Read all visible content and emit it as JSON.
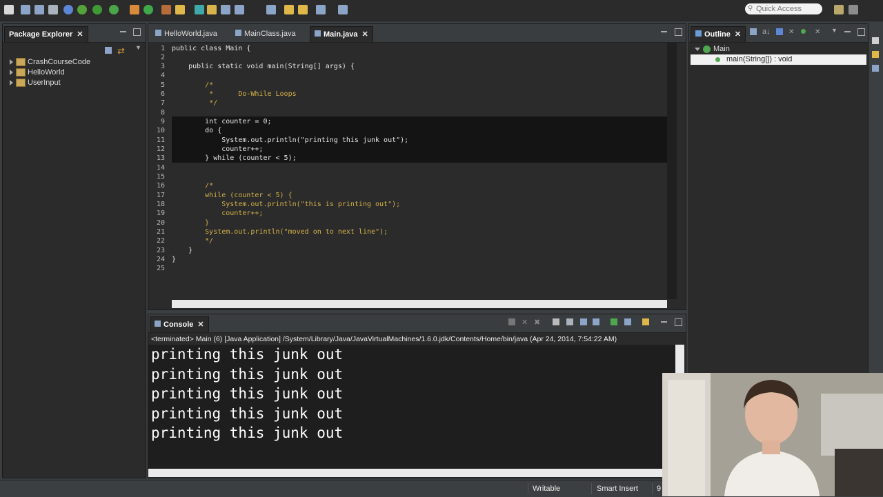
{
  "toolbar": {
    "search_placeholder": "Quick Access",
    "buttons": [
      "new-icon",
      "save-icon",
      "save-all-icon",
      "print-icon",
      "debug-icon",
      "run-icon",
      "run-last-icon",
      "external-tools-icon",
      "new-package-icon",
      "new-class-icon",
      "open-type-icon",
      "search-icon",
      "annotation-icon",
      "next-annotation-icon",
      "prev-annotation-icon",
      "back-icon",
      "forward-icon",
      "pin-icon"
    ]
  },
  "package_explorer": {
    "title": "Package Explorer",
    "projects": [
      "CrashCourseCode",
      "HelloWorld",
      "UserInput"
    ]
  },
  "editor": {
    "tabs": [
      {
        "label": "HelloWorld.java",
        "active": false
      },
      {
        "label": "MainClass.java",
        "active": false
      },
      {
        "label": "Main.java",
        "active": true
      }
    ],
    "line_numbers": [
      "1",
      "2",
      "3",
      "4",
      "5",
      "6",
      "7",
      "8",
      "9",
      "10",
      "11",
      "12",
      "13",
      "14",
      "15",
      "16",
      "17",
      "18",
      "19",
      "20",
      "21",
      "22",
      "23",
      "24",
      "25"
    ],
    "lines": [
      "public class Main {",
      "",
      "    public static void main(String[] args) {",
      "",
      "        /*",
      "         *      Do-While Loops",
      "         */",
      "",
      "        int counter = 0;",
      "        do {",
      "            System.out.println(\"printing this junk out\");",
      "            counter++;",
      "        } while (counter < 5);",
      "",
      "",
      "        /*",
      "        while (counter < 5) {",
      "            System.out.println(\"this is printing out\");",
      "            counter++;",
      "        }",
      "        System.out.println(\"moved on to next line\");",
      "        */",
      "    }",
      "}",
      ""
    ]
  },
  "outline": {
    "title": "Outline",
    "class_name": "Main",
    "method": "main(String[]) : void"
  },
  "console": {
    "title": "Console",
    "status": "<terminated> Main (6) [Java Application] /System/Library/Java/JavaVirtualMachines/1.6.0.jdk/Contents/Home/bin/java (Apr 24, 2014, 7:54:22 AM)",
    "output": [
      "printing this junk out",
      "printing this junk out",
      "printing this junk out",
      "printing this junk out",
      "printing this junk out"
    ]
  },
  "statusbar": {
    "writable": "Writable",
    "insert_mode": "Smart Insert",
    "position": "9"
  },
  "colors": {
    "background": "#2b2b2b",
    "chrome": "#3c3f41",
    "keyword": "#ffffff",
    "type": "#cc7832",
    "variable": "#9876aa",
    "comment": "#d4b04a",
    "number": "#6897bb"
  }
}
